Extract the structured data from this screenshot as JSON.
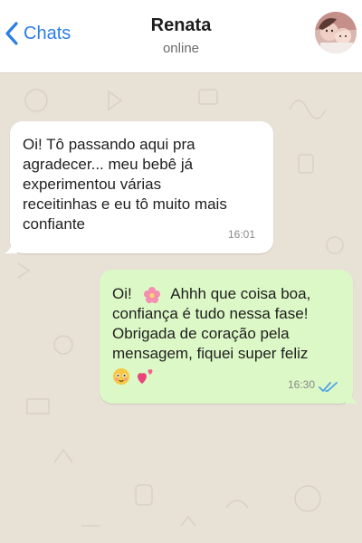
{
  "header": {
    "back_label": "Chats",
    "contact_name": "Renata",
    "status": "online"
  },
  "messages": [
    {
      "direction": "incoming",
      "lines": [
        "Oi! Tô passando aqui pra",
        "agradecer... meu bebê já",
        "experimentou várias",
        "receitinhas e eu tô muito mais",
        "confiante"
      ],
      "time": "16:01"
    },
    {
      "direction": "outgoing",
      "lines": [
        "Oi!",
        "Ahhh que coisa boa,",
        "confiança é tudo nessa fase!",
        "Obrigada de coração pela",
        "mensagem, fiquei super feliz"
      ],
      "emojis": [
        "flower-emoji",
        "smiling-face-emoji",
        "hearts-emoji"
      ],
      "time": "16:30",
      "read_status": "read"
    }
  ],
  "colors": {
    "accent": "#2a7ee6",
    "incoming_bubble": "#ffffff",
    "outgoing_bubble": "#dcf8c6",
    "read_ticks": "#4fa3e6",
    "chat_background": "#e7e1d6"
  }
}
